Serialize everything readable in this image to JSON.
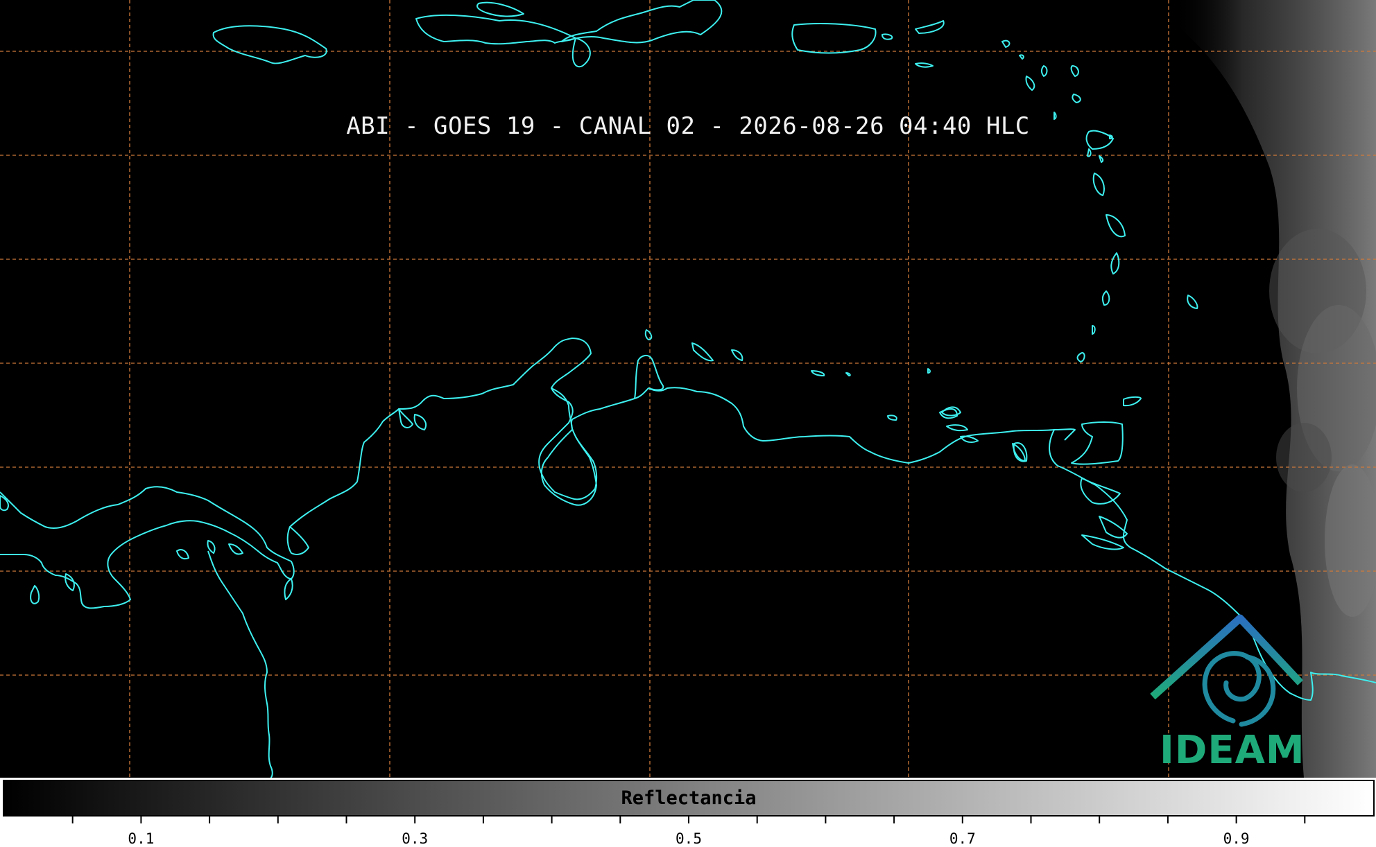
{
  "title": "ABI - GOES 19 - CANAL 02 - 2026-08-26 04:40 HLC",
  "logo": {
    "text": "IDEAM",
    "colors": [
      "#2a7fbf",
      "#1faa7a"
    ]
  },
  "colorbar": {
    "label": "Reflectancia",
    "range": [
      0.0,
      1.0
    ],
    "tick_labels": [
      "0.1",
      "0.3",
      "0.5",
      "0.7",
      "0.9"
    ],
    "tick_values": [
      0.1,
      0.3,
      0.5,
      0.7,
      0.9
    ],
    "minor_step": 0.05,
    "gradient": [
      "#000000",
      "#ffffff"
    ]
  },
  "map": {
    "background": "#000000",
    "coastline_color": "#3ef0f0",
    "gridline_color": "#d07a3a",
    "gridline_style": "dashed",
    "cloud_field": "east-edge"
  }
}
